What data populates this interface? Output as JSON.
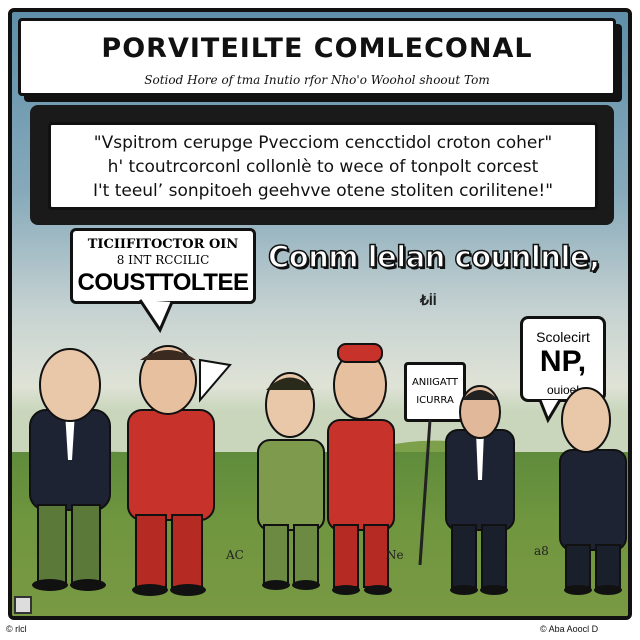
{
  "header": {
    "title": "PORVITEILTE COMLECONAL",
    "subtitle": "Sotiod Hore of tma Inutio rfor Nho'o Woohol shoout Tom"
  },
  "quote": {
    "lines": [
      "\"Vspitrom cerupge Pvecciom cencctidol croton coher\"",
      "h' tcoutrcorconl collonlè to wece of tonpolt corcest",
      "I't teeul’ sonpitoeh geehvve otene stoliten corilitene!\""
    ]
  },
  "bubble_left": {
    "line1": "TICIIFITOCTOR OIN",
    "line2": "8 INT  RCCILIC",
    "line3": "COUSTTOLTEE"
  },
  "big_caption": "Conm lelan counlnle,",
  "small_mark": "₺İİ",
  "bubble_right": {
    "line1": "Scolecirt",
    "line2": "NP,",
    "line3": "ouioel"
  },
  "sign": {
    "line1": "ANIIGATT",
    "line2": "ICURRA"
  },
  "ground_marks": [
    "AC",
    "Ne",
    "a8"
  ],
  "footer": {
    "left": "© rlcl",
    "right": "© Aba Aoocl D"
  },
  "colors": {
    "sky_top": "#5f8fa9",
    "grass": "#6f963f",
    "red_suit": "#c7332a",
    "dark_suit": "#1d2333",
    "green_uniform": "#7d9a4d"
  }
}
